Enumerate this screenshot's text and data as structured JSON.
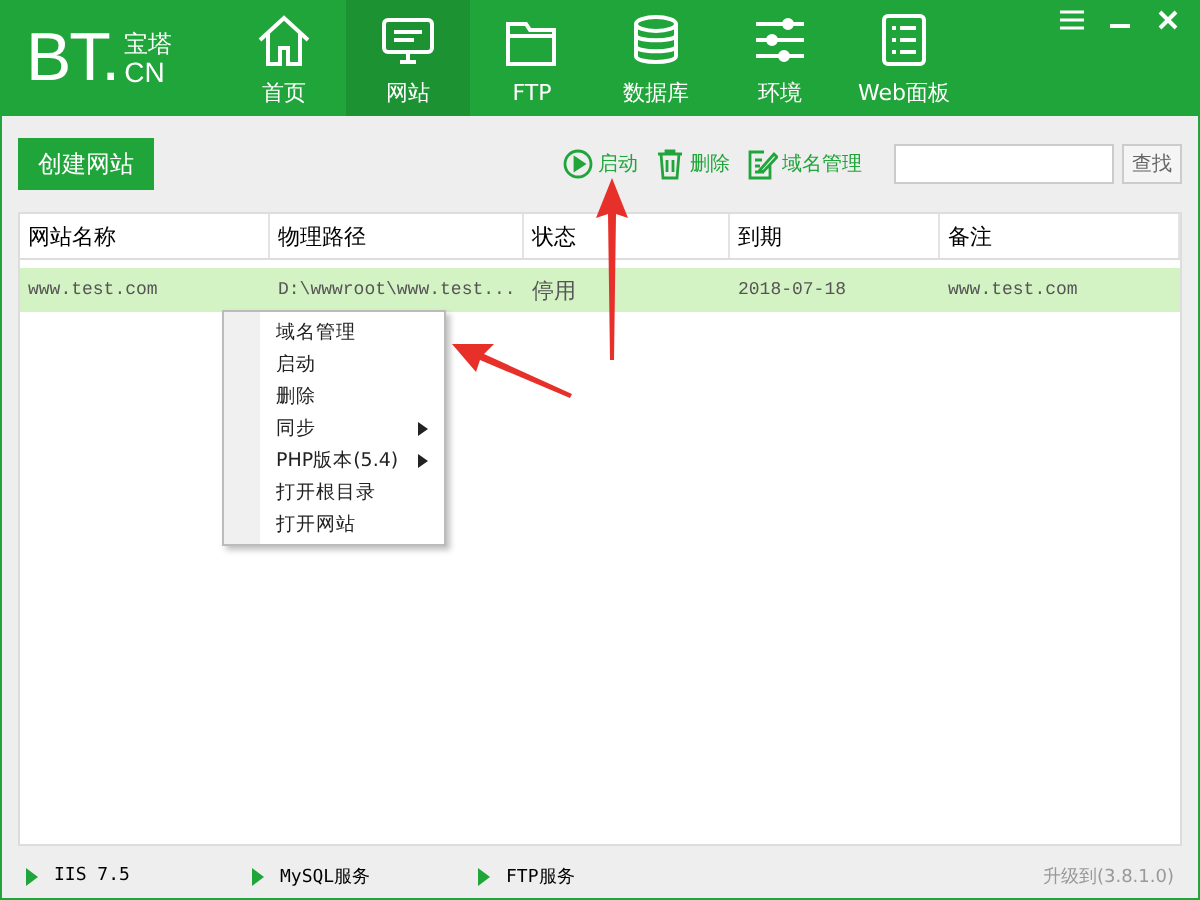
{
  "logo": {
    "main": "BT.",
    "top": "宝塔",
    "bottom": "CN"
  },
  "nav": [
    {
      "label": "首页",
      "selected": false
    },
    {
      "label": "网站",
      "selected": true
    },
    {
      "label": "FTP",
      "selected": false
    },
    {
      "label": "数据库",
      "selected": false
    },
    {
      "label": "环境",
      "selected": false
    },
    {
      "label": "Web面板",
      "selected": false
    }
  ],
  "create_button": "创建网站",
  "toolbar": [
    {
      "label": "启动"
    },
    {
      "label": "删除"
    },
    {
      "label": "域名管理"
    }
  ],
  "search_button": "查找",
  "table": {
    "columns": [
      "网站名称",
      "物理路径",
      "状态",
      "到期",
      "备注"
    ],
    "rows": [
      {
        "selected": true,
        "cells": [
          "www.test.com",
          "D:\\wwwroot\\www.test...",
          "停用",
          "2018-07-18",
          "www.test.com"
        ]
      }
    ]
  },
  "context_menu": [
    {
      "label": "域名管理",
      "submenu": false
    },
    {
      "label": "启动",
      "submenu": false
    },
    {
      "label": "删除",
      "submenu": false
    },
    {
      "label": "同步",
      "submenu": true
    },
    {
      "label": "PHP版本(5.4)",
      "submenu": true
    },
    {
      "label": "打开根目录",
      "submenu": false
    },
    {
      "label": "打开网站",
      "submenu": false
    }
  ],
  "status_bar": {
    "services": [
      "IIS 7.5",
      "MySQL服务",
      "FTP服务"
    ],
    "upgrade": "升级到(3.8.1.0)"
  }
}
